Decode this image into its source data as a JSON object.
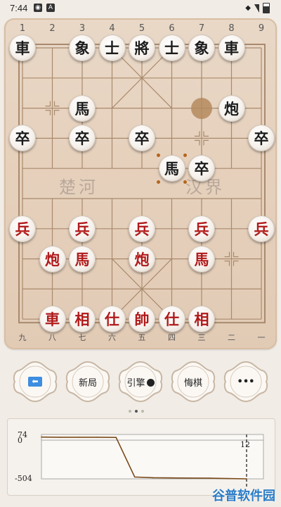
{
  "status": {
    "time": "7:44"
  },
  "board": {
    "file_numbers_top": [
      "1",
      "2",
      "3",
      "4",
      "5",
      "6",
      "7",
      "8",
      "9"
    ],
    "file_numbers_bottom": [
      "九",
      "八",
      "七",
      "六",
      "五",
      "四",
      "三",
      "二",
      "一"
    ],
    "river_left": "楚河",
    "river_right": "汉界",
    "pieces": [
      {
        "side": "black",
        "char": "車",
        "file": 0,
        "rank": 0
      },
      {
        "side": "black",
        "char": "象",
        "file": 2,
        "rank": 0
      },
      {
        "side": "black",
        "char": "士",
        "file": 3,
        "rank": 0
      },
      {
        "side": "black",
        "char": "將",
        "file": 4,
        "rank": 0
      },
      {
        "side": "black",
        "char": "士",
        "file": 5,
        "rank": 0
      },
      {
        "side": "black",
        "char": "象",
        "file": 6,
        "rank": 0
      },
      {
        "side": "black",
        "char": "車",
        "file": 7,
        "rank": 0
      },
      {
        "side": "black",
        "char": "馬",
        "file": 2,
        "rank": 2
      },
      {
        "side": "black",
        "char": "炮",
        "file": 7,
        "rank": 2
      },
      {
        "side": "black",
        "char": "卒",
        "file": 0,
        "rank": 3
      },
      {
        "side": "black",
        "char": "卒",
        "file": 2,
        "rank": 3
      },
      {
        "side": "black",
        "char": "卒",
        "file": 4,
        "rank": 3
      },
      {
        "side": "black",
        "char": "卒",
        "file": 8,
        "rank": 3
      },
      {
        "side": "black",
        "char": "馬",
        "file": 5,
        "rank": 4
      },
      {
        "side": "black",
        "char": "卒",
        "file": 6,
        "rank": 4
      },
      {
        "side": "red",
        "char": "兵",
        "file": 0,
        "rank": 6
      },
      {
        "side": "red",
        "char": "兵",
        "file": 2,
        "rank": 6
      },
      {
        "side": "red",
        "char": "兵",
        "file": 4,
        "rank": 6
      },
      {
        "side": "red",
        "char": "兵",
        "file": 6,
        "rank": 6
      },
      {
        "side": "red",
        "char": "兵",
        "file": 8,
        "rank": 6
      },
      {
        "side": "red",
        "char": "炮",
        "file": 1,
        "rank": 7
      },
      {
        "side": "red",
        "char": "馬",
        "file": 2,
        "rank": 7
      },
      {
        "side": "red",
        "char": "炮",
        "file": 4,
        "rank": 7
      },
      {
        "side": "red",
        "char": "馬",
        "file": 6,
        "rank": 7
      },
      {
        "side": "red",
        "char": "車",
        "file": 1,
        "rank": 9
      },
      {
        "side": "red",
        "char": "相",
        "file": 2,
        "rank": 9
      },
      {
        "side": "red",
        "char": "仕",
        "file": 3,
        "rank": 9
      },
      {
        "side": "red",
        "char": "帥",
        "file": 4,
        "rank": 9
      },
      {
        "side": "red",
        "char": "仕",
        "file": 5,
        "rank": 9
      },
      {
        "side": "red",
        "char": "相",
        "file": 6,
        "rank": 9
      }
    ],
    "last_move_from": {
      "file": 6,
      "rank": 2
    },
    "selected": {
      "file": 5,
      "rank": 4
    },
    "colors": {
      "black_piece": "#1c1c1c",
      "red_piece": "#b01a1a",
      "grid": "#a98a6d"
    }
  },
  "controls": {
    "back_icon": "⬅",
    "new_game": "新局",
    "engine": "引擎",
    "undo": "悔棋",
    "more": "•••"
  },
  "chart_data": {
    "type": "line",
    "title": "",
    "xlabel": "",
    "ylabel": "",
    "y_tick_labels": [
      "74",
      "0",
      "-504"
    ],
    "ylim": [
      -504,
      74
    ],
    "x_marker_label": "12",
    "x": [
      1,
      2,
      3,
      4,
      5,
      6,
      7,
      8,
      9,
      10,
      11,
      12
    ],
    "series": [
      {
        "values": [
          40,
          38,
          38,
          38,
          36,
          -480,
          -490,
          -492,
          -494,
          -495,
          -500,
          -504
        ]
      }
    ]
  },
  "watermark": "谷普软件园"
}
